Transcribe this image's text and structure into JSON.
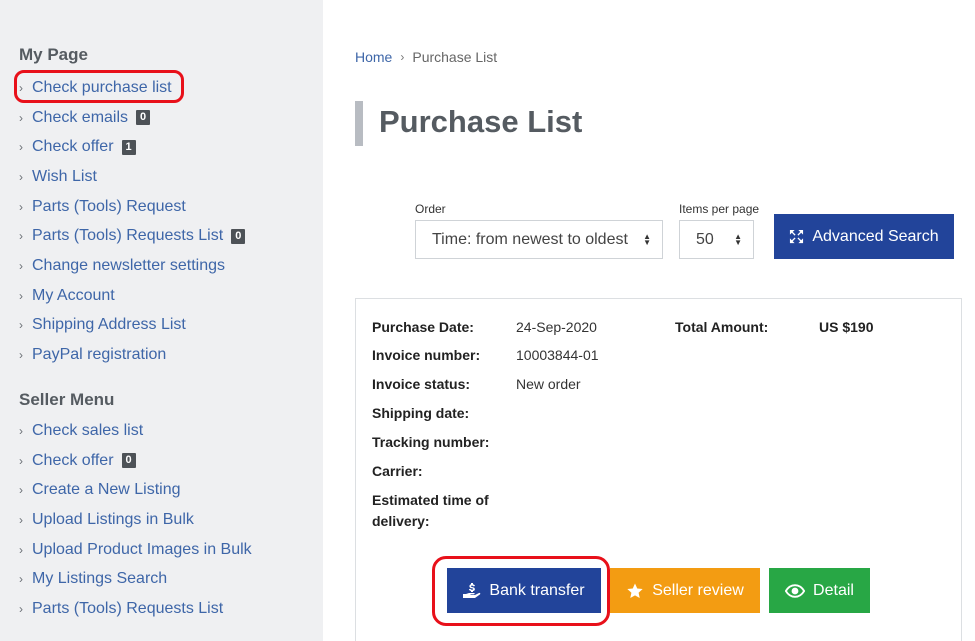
{
  "sidebar": {
    "my_page": {
      "title": "My Page",
      "items": [
        {
          "label": "Check purchase list",
          "badge": null
        },
        {
          "label": "Check emails",
          "badge": "0"
        },
        {
          "label": "Check offer",
          "badge": "1"
        },
        {
          "label": "Wish List",
          "badge": null
        },
        {
          "label": "Parts (Tools) Request",
          "badge": null
        },
        {
          "label": "Parts (Tools) Requests List",
          "badge": "0"
        },
        {
          "label": "Change newsletter settings",
          "badge": null
        },
        {
          "label": "My Account",
          "badge": null
        },
        {
          "label": "Shipping Address List",
          "badge": null
        },
        {
          "label": "PayPal registration",
          "badge": null
        }
      ]
    },
    "seller_menu": {
      "title": "Seller Menu",
      "items": [
        {
          "label": "Check sales list",
          "badge": null
        },
        {
          "label": "Check offer",
          "badge": "0"
        },
        {
          "label": "Create a New Listing",
          "badge": null
        },
        {
          "label": "Upload Listings in Bulk",
          "badge": null
        },
        {
          "label": "Upload Product Images in Bulk",
          "badge": null
        },
        {
          "label": "My Listings Search",
          "badge": null
        },
        {
          "label": "Parts (Tools) Requests List",
          "badge": null
        }
      ]
    }
  },
  "breadcrumb": {
    "home": "Home",
    "current": "Purchase List"
  },
  "page_title": "Purchase List",
  "filters": {
    "order_label": "Order",
    "order_value": "Time: from newest to oldest",
    "items_label": "Items per page",
    "items_value": "50",
    "advanced_search": "Advanced Search"
  },
  "purchase": {
    "purchase_date_label": "Purchase Date:",
    "purchase_date": "24-Sep-2020",
    "total_amount_label": "Total Amount:",
    "total_amount": "US $190",
    "invoice_number_label": "Invoice number:",
    "invoice_number": "10003844-01",
    "invoice_status_label": "Invoice status:",
    "invoice_status": "New order",
    "shipping_date_label": "Shipping date:",
    "tracking_number_label": "Tracking number:",
    "carrier_label": "Carrier:",
    "eta_label_line1": "Estimated time of",
    "eta_label_line2": "delivery:"
  },
  "actions": {
    "bank_transfer": "Bank transfer",
    "seller_review": "Seller review",
    "detail": "Detail"
  },
  "colors": {
    "primary": "#22449a",
    "warning": "#f39c12",
    "success": "#28a745",
    "highlight": "#e8101a",
    "link": "#3e66a8"
  }
}
